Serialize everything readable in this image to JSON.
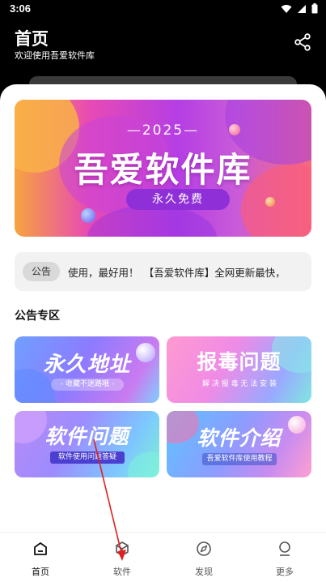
{
  "status_bar": {
    "time": "3:06",
    "icons": [
      "wifi-icon",
      "signal-icon",
      "battery-icon"
    ]
  },
  "header": {
    "title": "首页",
    "subtitle": "欢迎使用吾爱软件库",
    "share_icon": "share-icon"
  },
  "hero": {
    "year": "2025",
    "title": "吾爱软件库",
    "pill": "永久免费"
  },
  "notice": {
    "badge": "公告",
    "text": "使用，最好用！　【吾爱软件库】全网更新最快，"
  },
  "section": {
    "title": "公告专区"
  },
  "tiles": [
    {
      "title": "永久地址",
      "subtitle": "- 收藏不迷路哦 -"
    },
    {
      "title": "报毒问题",
      "subtitle": "解 决 报 毒 无 法 安 装"
    },
    {
      "title": "软件问题",
      "subtitle": "软件使用问题答疑"
    },
    {
      "title": "软件介绍",
      "subtitle": "吾爱软件库使用教程"
    }
  ],
  "bottom_nav": {
    "items": [
      {
        "label": "首页",
        "icon": "home-icon",
        "active": true
      },
      {
        "label": "软件",
        "icon": "cube-icon",
        "active": false
      },
      {
        "label": "发现",
        "icon": "compass-icon",
        "active": false
      },
      {
        "label": "更多",
        "icon": "person-icon",
        "active": false
      }
    ]
  },
  "colors": {
    "background": "#000000",
    "sheet": "#ffffff",
    "hero_gradient": [
      "#f6a43e",
      "#e84ab4",
      "#b53ee4",
      "#f76a7a"
    ],
    "annotation_arrow": "#e02020"
  }
}
